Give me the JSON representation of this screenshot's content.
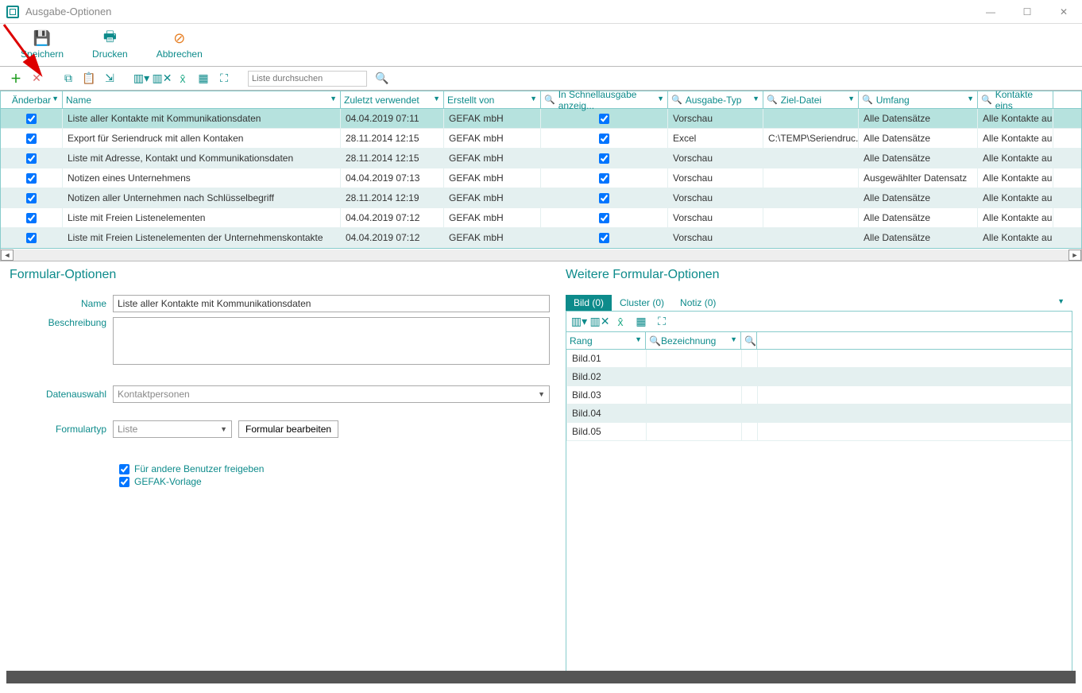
{
  "window": {
    "title": "Ausgabe-Optionen"
  },
  "toolbar": {
    "save": "Speichern",
    "print": "Drucken",
    "cancel": "Abbrechen"
  },
  "search": {
    "placeholder": "Liste durchsuchen"
  },
  "grid": {
    "columns": {
      "aenderbar": "Änderbar",
      "name": "Name",
      "zuletzt": "Zuletzt verwendet",
      "erstellt": "Erstellt von",
      "schnell": "In Schnellausgabe anzeig...",
      "typ": "Ausgabe-Typ",
      "datei": "Ziel-Datei",
      "umfang": "Umfang",
      "kontakte": "Kontakte eins"
    },
    "rows": [
      {
        "aenderbar": true,
        "name": "Liste aller Kontakte mit Kommunikationsdaten",
        "zuletzt": "04.04.2019 07:11",
        "erstellt": "GEFAK mbH",
        "schnell": true,
        "typ": "Vorschau",
        "datei": "",
        "umfang": "Alle Datensätze",
        "kontakte": "Alle Kontakte au"
      },
      {
        "aenderbar": true,
        "name": "Export für Seriendruck mit allen Kontaken",
        "zuletzt": "28.11.2014 12:15",
        "erstellt": "GEFAK mbH",
        "schnell": true,
        "typ": "Excel",
        "datei": "C:\\TEMP\\Seriendruc...",
        "umfang": "Alle Datensätze",
        "kontakte": "Alle Kontakte au"
      },
      {
        "aenderbar": true,
        "name": "Liste mit Adresse, Kontakt und Kommunikationsdaten",
        "zuletzt": "28.11.2014 12:15",
        "erstellt": "GEFAK mbH",
        "schnell": true,
        "typ": "Vorschau",
        "datei": "",
        "umfang": "Alle Datensätze",
        "kontakte": "Alle Kontakte au"
      },
      {
        "aenderbar": true,
        "name": "Notizen eines Unternehmens",
        "zuletzt": "04.04.2019 07:13",
        "erstellt": "GEFAK mbH",
        "schnell": true,
        "typ": "Vorschau",
        "datei": "",
        "umfang": "Ausgewählter Datensatz",
        "kontakte": "Alle Kontakte au"
      },
      {
        "aenderbar": true,
        "name": "Notizen aller Unternehmen nach Schlüsselbegriff",
        "zuletzt": "28.11.2014 12:19",
        "erstellt": "GEFAK mbH",
        "schnell": true,
        "typ": "Vorschau",
        "datei": "",
        "umfang": "Alle Datensätze",
        "kontakte": "Alle Kontakte au"
      },
      {
        "aenderbar": true,
        "name": "Liste mit Freien Listenelementen",
        "zuletzt": "04.04.2019 07:12",
        "erstellt": "GEFAK mbH",
        "schnell": true,
        "typ": "Vorschau",
        "datei": "",
        "umfang": "Alle Datensätze",
        "kontakte": "Alle Kontakte au"
      },
      {
        "aenderbar": true,
        "name": "Liste mit Freien Listenelementen der Unternehmenskontakte",
        "zuletzt": "04.04.2019 07:12",
        "erstellt": "GEFAK mbH",
        "schnell": true,
        "typ": "Vorschau",
        "datei": "",
        "umfang": "Alle Datensätze",
        "kontakte": "Alle Kontakte au"
      }
    ]
  },
  "formOptions": {
    "title": "Formular-Optionen",
    "labels": {
      "name": "Name",
      "beschreibung": "Beschreibung",
      "datenauswahl": "Datenauswahl",
      "formulartyp": "Formulartyp"
    },
    "values": {
      "name": "Liste aller Kontakte mit Kommunikationsdaten",
      "beschreibung": "",
      "datenauswahl": "Kontaktpersonen",
      "formulartyp": "Liste"
    },
    "editBtn": "Formular bearbeiten",
    "chk1": "Für andere Benutzer freigeben",
    "chk2": "GEFAK-Vorlage"
  },
  "moreOptions": {
    "title": "Weitere Formular-Optionen",
    "tabs": {
      "bild": "Bild (0)",
      "cluster": "Cluster (0)",
      "notiz": "Notiz (0)"
    },
    "columns": {
      "rang": "Rang",
      "bez": "Bezeichnung"
    },
    "rows": [
      "Bild.01",
      "Bild.02",
      "Bild.03",
      "Bild.04",
      "Bild.05"
    ]
  }
}
